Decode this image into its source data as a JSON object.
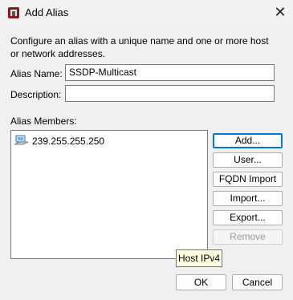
{
  "window": {
    "title": "Add Alias"
  },
  "intro_text": "Configure an alias with a unique name and one or more host or network addresses.",
  "alias_name": {
    "label": "Alias Name:",
    "value": "SSDP-Multicast"
  },
  "description": {
    "label": "Description:",
    "value": ""
  },
  "members": {
    "label": "Alias Members:",
    "items": [
      {
        "icon": "host-ipv4-icon",
        "text": "239.255.255.250"
      }
    ]
  },
  "buttons": {
    "add": "Add...",
    "user": "User...",
    "fqdn_import": "FQDN Import",
    "import": "Import...",
    "export": "Export...",
    "remove": "Remove",
    "ok": "OK",
    "cancel": "Cancel"
  },
  "tooltip": "Host IPv4",
  "colors": {
    "default_button_border": "#0078d4",
    "tooltip_bg": "#ffffe1"
  }
}
